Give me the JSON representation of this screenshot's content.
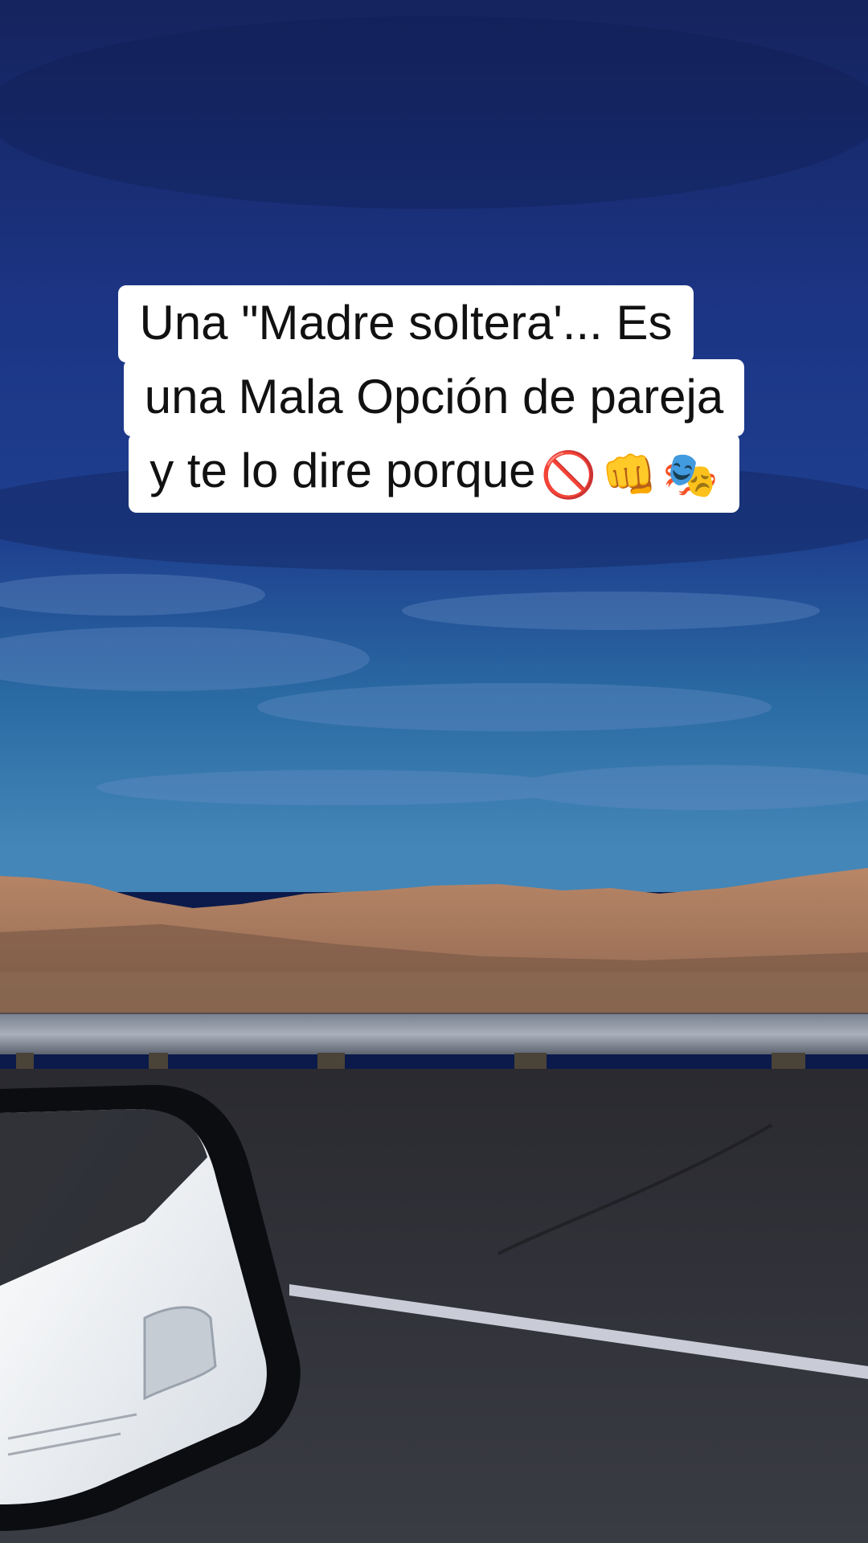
{
  "caption": {
    "line1": "Una \"Madre soltera'... Es",
    "line2": "una Mala Opción de pareja",
    "line3_text": "y te lo dire porque",
    "line3_emojis": [
      "🚫",
      "👊",
      "🎭"
    ]
  },
  "scene": {
    "description_keys": [
      "sky-clouds",
      "desert-mountains",
      "guardrail",
      "road",
      "car-side-mirror"
    ],
    "colors": {
      "sky_top": "#1a2f7a",
      "sky_mid": "#1e3f8f",
      "horizon": "#2a6fa8",
      "mountains": "#b88566",
      "road": "#2b2c33",
      "mirror_body": "#f2f4f6"
    }
  }
}
